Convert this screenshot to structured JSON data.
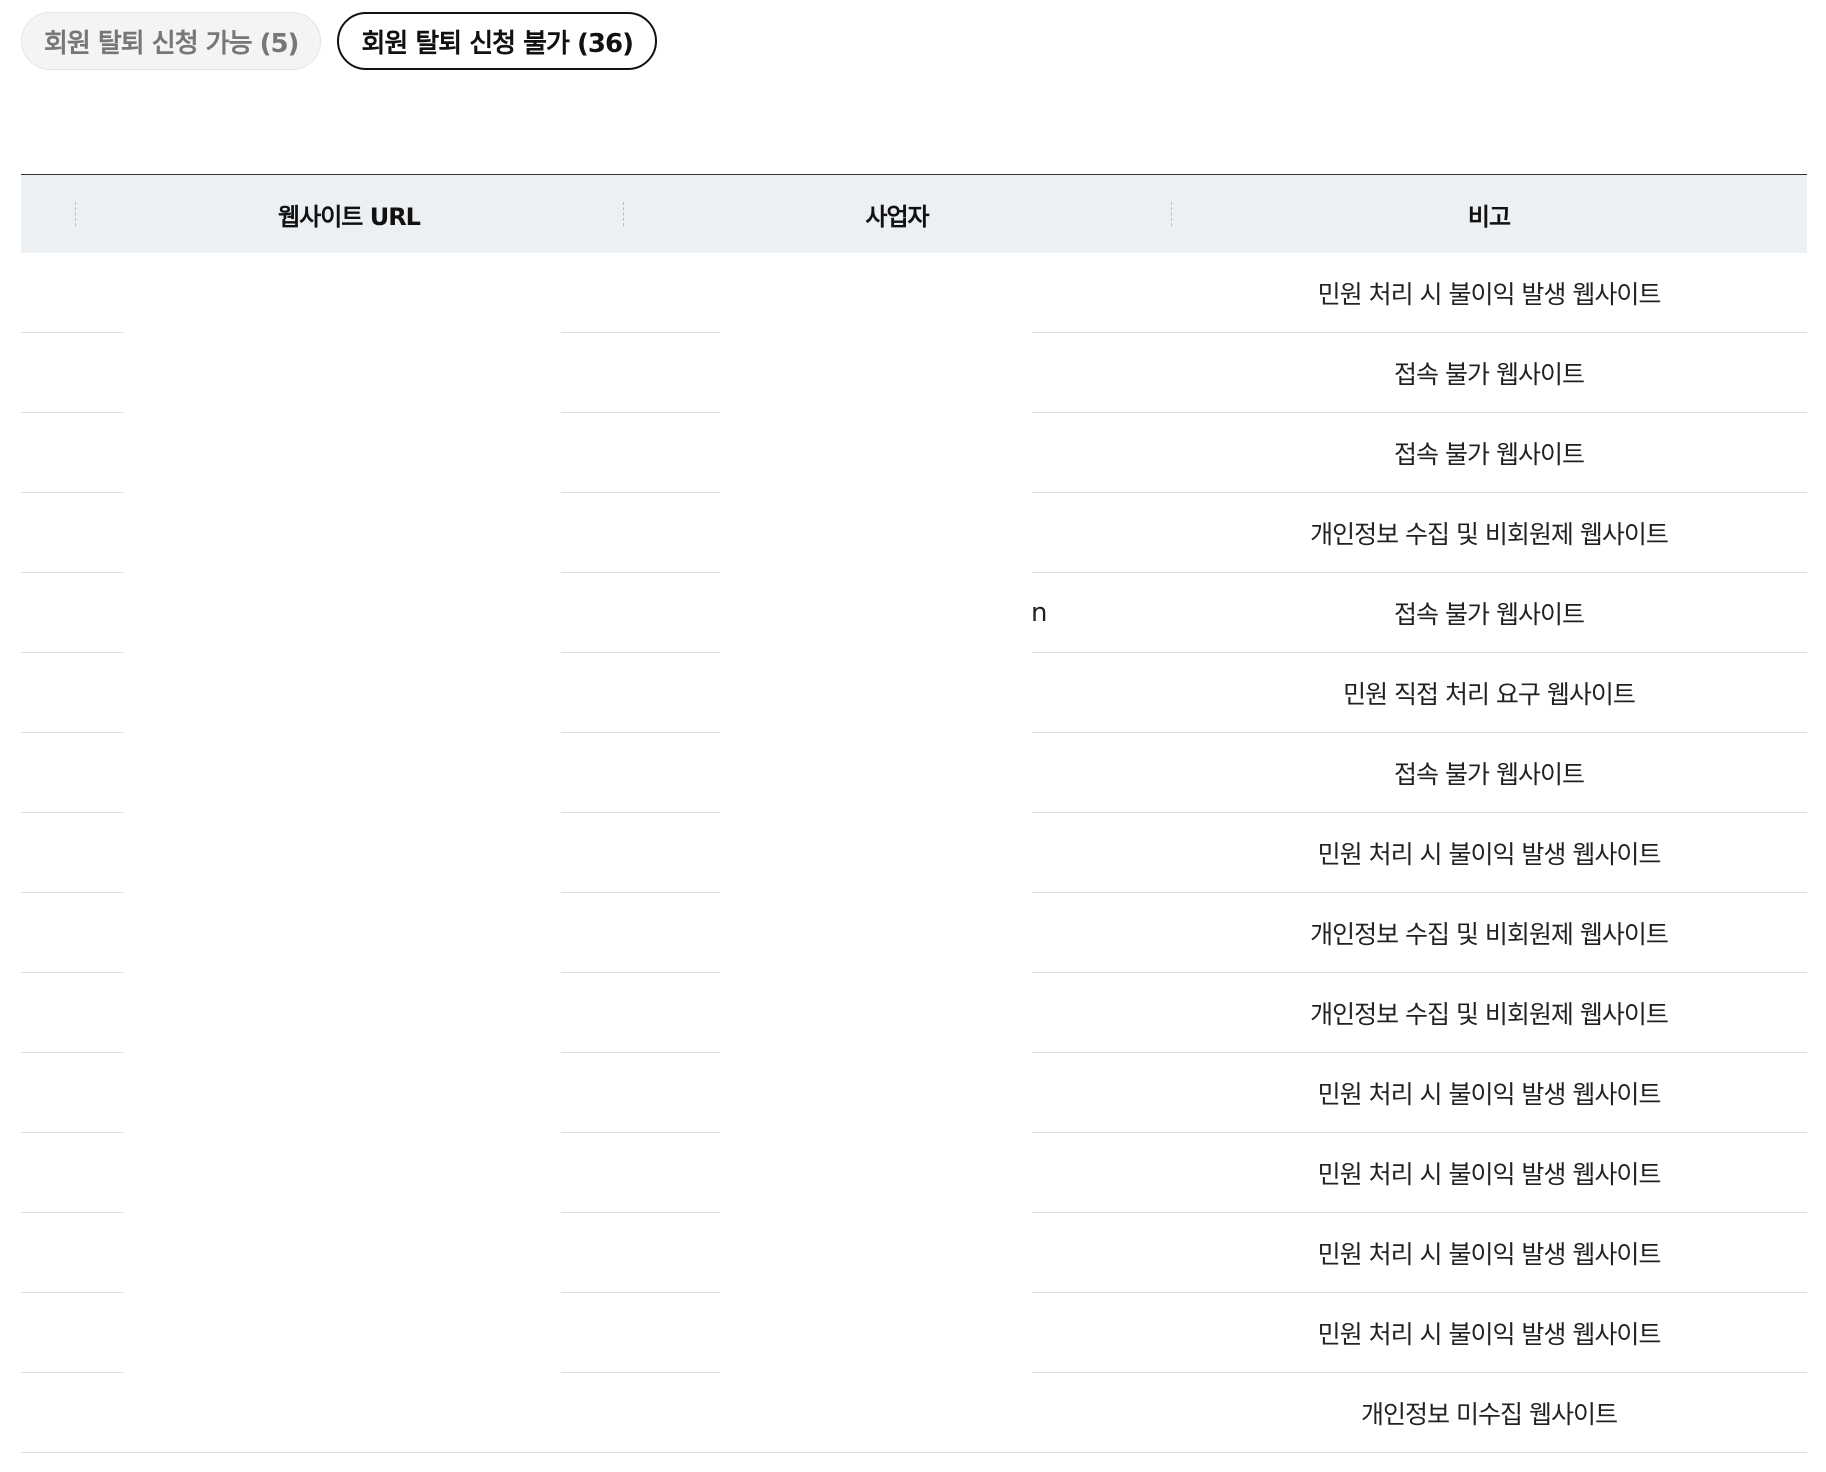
{
  "tabs": [
    {
      "label": "회원 탈퇴 신청 가능 (5)",
      "active": false
    },
    {
      "label": "회원 탈퇴 신청 불가 (36)",
      "active": true
    }
  ],
  "table": {
    "headers": [
      "",
      "웹사이트 URL",
      "사업자",
      "비고"
    ],
    "fragment": "n",
    "rows": [
      {
        "note": "민원 처리 시 불이익 발생 웹사이트"
      },
      {
        "note": "접속 불가 웹사이트"
      },
      {
        "note": "접속 불가 웹사이트"
      },
      {
        "note": "개인정보 수집 및 비회원제 웹사이트"
      },
      {
        "note": "접속 불가 웹사이트"
      },
      {
        "note": "민원 직접 처리 요구 웹사이트"
      },
      {
        "note": "접속 불가 웹사이트"
      },
      {
        "note": "민원 처리 시 불이익 발생 웹사이트"
      },
      {
        "note": "개인정보 수집 및 비회원제 웹사이트"
      },
      {
        "note": "개인정보 수집 및 비회원제 웹사이트"
      },
      {
        "note": "민원 처리 시 불이익 발생 웹사이트"
      },
      {
        "note": "민원 처리 시 불이익 발생 웹사이트"
      },
      {
        "note": "민원 처리 시 불이익 발생 웹사이트"
      },
      {
        "note": "민원 처리 시 불이익 발생 웹사이트"
      },
      {
        "note": "개인정보 미수집 웹사이트"
      }
    ]
  }
}
